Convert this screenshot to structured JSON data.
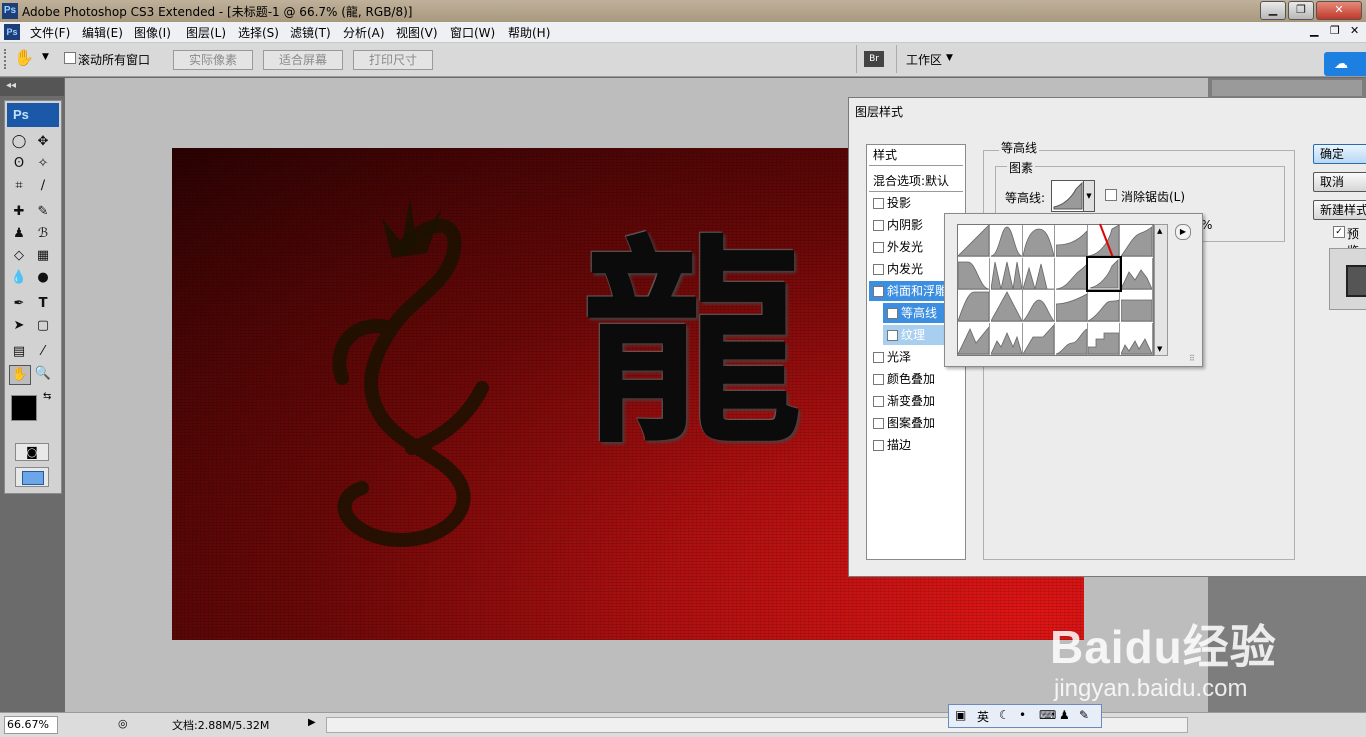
{
  "window": {
    "app_icon": "Ps",
    "title": "Adobe Photoshop CS3 Extended - [未标题-1 @ 66.7% (龍, RGB/8)]",
    "controls": [
      "minimize-icon",
      "restore-icon",
      "close-icon"
    ]
  },
  "menubar": {
    "doc_icon": "Ps",
    "items": [
      "文件(F)",
      "编辑(E)",
      "图像(I)",
      "图层(L)",
      "选择(S)",
      "滤镜(T)",
      "分析(A)",
      "视图(V)",
      "窗口(W)",
      "帮助(H)"
    ],
    "doc_controls": [
      "minimize-icon",
      "restore-icon",
      "close-icon"
    ]
  },
  "options": {
    "tool_icon": "hand-icon",
    "scroll_all_label": "滚动所有窗口",
    "actual_pixels": "实际像素",
    "fit_screen": "适合屏幕",
    "print_size": "打印尺寸",
    "workspace": "工作区",
    "bridge_label": "Br"
  },
  "tools": {
    "logo": "Ps"
  },
  "canvas": {
    "character": "龍"
  },
  "dialog": {
    "title": "图层样式",
    "styles_header": "样式",
    "blend_options": "混合选项:默认",
    "style_items": [
      {
        "label": "投影",
        "checked": false
      },
      {
        "label": "内阴影",
        "checked": false
      },
      {
        "label": "外发光",
        "checked": false
      },
      {
        "label": "内发光",
        "checked": false
      },
      {
        "label": "斜面和浮雕",
        "checked": true
      },
      {
        "label": "等高线",
        "checked": true
      },
      {
        "label": "纹理",
        "checked": false
      },
      {
        "label": "光泽",
        "checked": false
      },
      {
        "label": "颜色叠加",
        "checked": false
      },
      {
        "label": "渐变叠加",
        "checked": false
      },
      {
        "label": "图案叠加",
        "checked": false
      },
      {
        "label": "描边",
        "checked": false
      }
    ],
    "section_title": "等高线",
    "group_title": "图素",
    "contour_label": "等高线:",
    "anti_alias_label": "消除锯齿(L)",
    "percent_sign": "%",
    "ok": "确定",
    "cancel": "取消",
    "new_style": "新建样式(W)...",
    "preview": "预览(V)"
  },
  "status": {
    "zoom": "66.67%",
    "doc_info": "文档:2.88M/5.32M"
  },
  "ime": {
    "lang": "英"
  },
  "watermark": {
    "brand": "Baidu经验",
    "url": "jingyan.baidu.com"
  },
  "colors": {
    "accent_blue": "#3c8ee0",
    "canvas_red": "#c81212",
    "arrow_red": "#e00000"
  }
}
